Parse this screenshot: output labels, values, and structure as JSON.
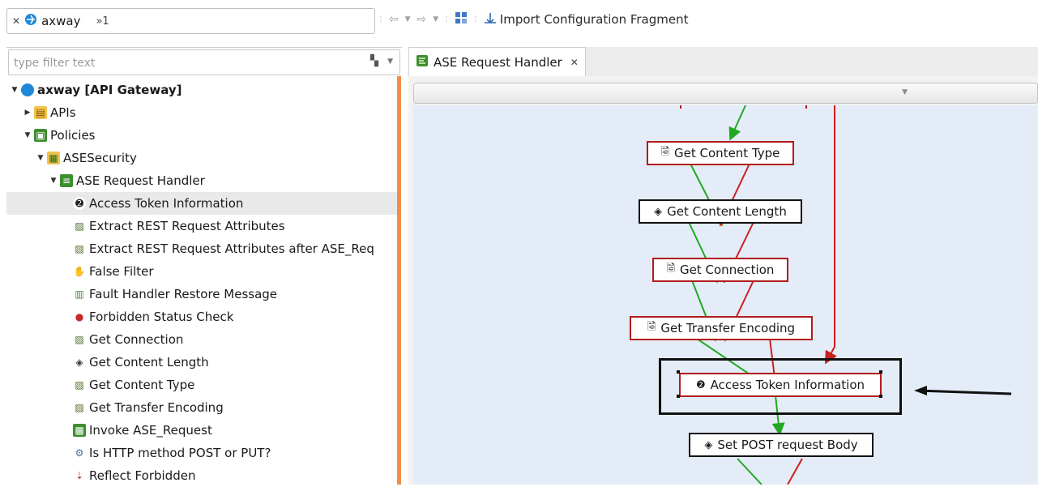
{
  "workspace": {
    "label": "axway",
    "marker": "»1"
  },
  "toolbar": {
    "import_label": "Import Configuration Fragment"
  },
  "filter": {
    "placeholder": "type filter text"
  },
  "tree": [
    {
      "label": "axway [API Gateway]",
      "icon": "globe-icon",
      "level": 0,
      "expanded": true,
      "bold": true
    },
    {
      "label": "APIs",
      "icon": "apis-folder-icon",
      "level": 1,
      "expanded": false
    },
    {
      "label": "Policies",
      "icon": "policies-icon",
      "level": 1,
      "expanded": true
    },
    {
      "label": "ASESecurity",
      "icon": "container-folder-icon",
      "level": 2,
      "expanded": true
    },
    {
      "label": "ASE Request Handler",
      "icon": "policy-icon",
      "level": 3,
      "expanded": true
    },
    {
      "label": "Access Token Information",
      "icon": "access-token-icon",
      "level": 4,
      "selected": true
    },
    {
      "label": "Extract REST Request Attributes",
      "icon": "extract-icon",
      "level": 4
    },
    {
      "label": "Extract REST Request Attributes after ASE_Req",
      "icon": "extract-icon",
      "level": 4
    },
    {
      "label": "False Filter",
      "icon": "false-filter-icon",
      "level": 4
    },
    {
      "label": "Fault Handler Restore Message",
      "icon": "fault-handler-icon",
      "level": 4
    },
    {
      "label": "Forbidden Status Check",
      "icon": "status-check-icon",
      "level": 4
    },
    {
      "label": "Get Connection",
      "icon": "extract-icon",
      "level": 4
    },
    {
      "label": "Get Content Length",
      "icon": "eye-icon",
      "level": 4
    },
    {
      "label": "Get Content Type",
      "icon": "extract-icon",
      "level": 4
    },
    {
      "label": "Get Transfer Encoding",
      "icon": "extract-icon",
      "level": 4
    },
    {
      "label": "Invoke ASE_Request",
      "icon": "invoke-icon",
      "level": 4
    },
    {
      "label": "Is HTTP method POST or PUT?",
      "icon": "gear-icon",
      "level": 4
    },
    {
      "label": "Reflect Forbidden",
      "icon": "reflect-icon",
      "level": 4
    }
  ],
  "editor_tab": {
    "label": "ASE Request Handler",
    "close": "✕"
  },
  "canvas_nodes": [
    {
      "id": "get-content-type",
      "label": "Get Content Type",
      "icon": "extract-icon",
      "border": "#b21b1b"
    },
    {
      "id": "get-content-length",
      "label": "Get Content Length",
      "icon": "eye-icon",
      "border": "#111111"
    },
    {
      "id": "get-connection",
      "label": "Get Connection",
      "icon": "extract-icon",
      "border": "#b21b1b"
    },
    {
      "id": "get-transfer-encoding",
      "label": "Get Transfer Encoding",
      "icon": "extract-icon",
      "border": "#b21b1b"
    },
    {
      "id": "access-token-information",
      "label": "Access Token Information",
      "icon": "access-token-icon",
      "border": "#b21b1b",
      "selected": true
    },
    {
      "id": "set-post-request-body",
      "label": "Set POST request Body",
      "icon": "eye-icon",
      "border": "#111111"
    }
  ],
  "colors": {
    "success_path": "#22a822",
    "failure_path": "#cc1f1f",
    "accent": "#f08d4a",
    "canvas": "#e4ecf7"
  }
}
